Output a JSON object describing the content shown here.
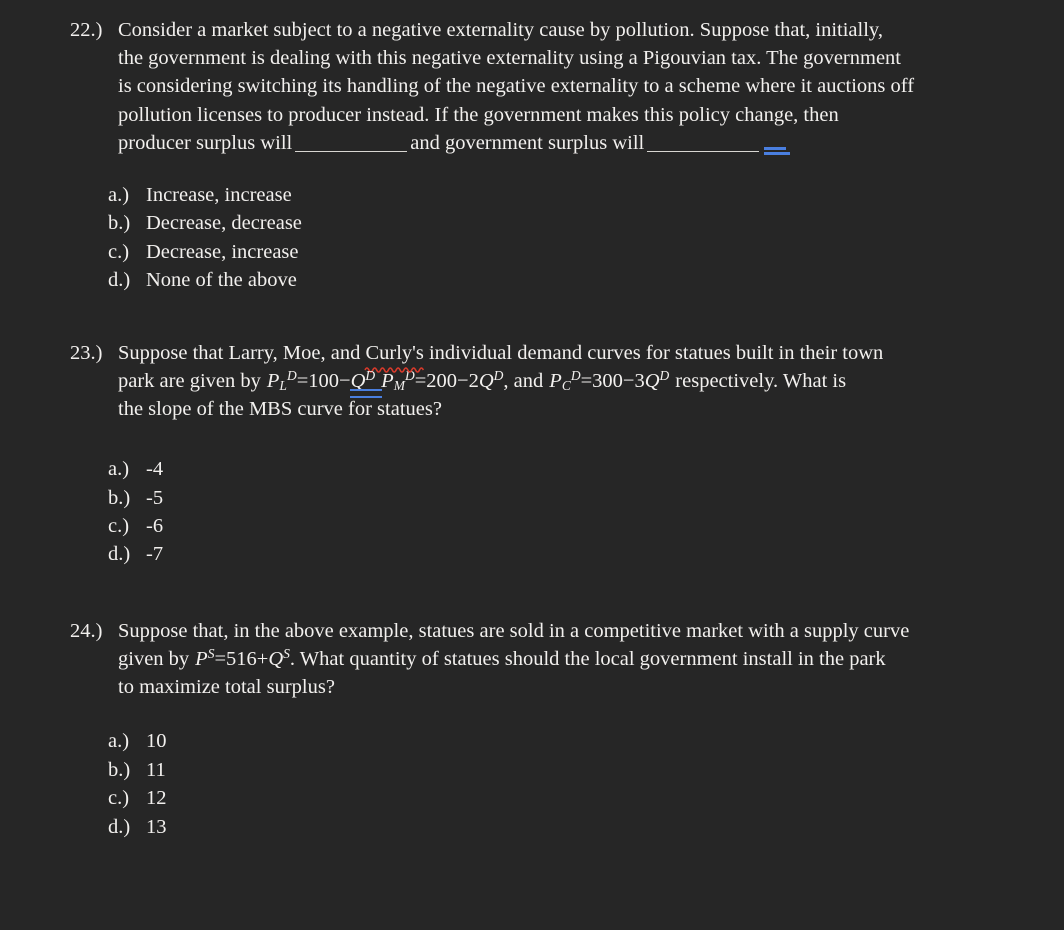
{
  "document": {
    "background_color": "#262626",
    "text_color": "#f2f0ee",
    "accent_blue": "#4a7fe0",
    "spellcheck_red": "#d93a2b"
  },
  "questions": [
    {
      "number": "22.)",
      "stem_lines": [
        "Consider a market subject to a negative externality cause by pollution.  Suppose that, initially,",
        "the government is dealing with this negative externality using a Pigouvian tax.  The government",
        "is considering switching its handling of the negative externality to a scheme where it auctions off",
        "pollution licenses to producer instead.  If the government makes this policy change, then",
        "producer surplus will ______________ and government surplus will ______________"
      ],
      "stem_part_a": "producer surplus will",
      "stem_part_b": "and government surplus will",
      "choices": [
        {
          "letter": "a.)",
          "text": "Increase, increase"
        },
        {
          "letter": "b.)",
          "text": "Decrease, decrease"
        },
        {
          "letter": "c.)",
          "text": "Decrease, increase"
        },
        {
          "letter": "d.)",
          "text": "None of the above"
        }
      ]
    },
    {
      "number": "23.)",
      "line1_before_spell": "Suppose that Larry, Moe, and ",
      "line1_spell_word": "Curly's",
      "line1_after_spell": " individual demand curves for statues built in their town",
      "line2_lead": "park are given by",
      "eq1": {
        "lhs_p": "P",
        "lhs_sub": "L",
        "lhs_sup": "D",
        "eq": "=",
        "rhs": "100−",
        "rhs_q": "Q",
        "rhs_q_sup": "D"
      },
      "eq2": {
        "lhs_p": "P",
        "lhs_sub": "M",
        "lhs_sup": "D",
        "eq": "=",
        "rhs": "200−2",
        "rhs_q": "Q",
        "rhs_q_sup": "D"
      },
      "eq2_tail": ", and",
      "eq3": {
        "lhs_p": "P",
        "lhs_sub": "C",
        "lhs_sup": "D",
        "eq": "=",
        "rhs": "300−3",
        "rhs_q": "Q",
        "rhs_q_sup": "D"
      },
      "eq3_tail": "respectively.  What is",
      "line3": "the slope of the MBS curve for statues?",
      "choices": [
        {
          "letter": "a.)",
          "text": "-4"
        },
        {
          "letter": "b.)",
          "text": "-5"
        },
        {
          "letter": "c.)",
          "text": "-6"
        },
        {
          "letter": "d.)",
          "text": "-7"
        }
      ]
    },
    {
      "number": "24.)",
      "line1": "Suppose that, in the above example, statues are sold in a competitive market with a supply curve",
      "line2_lead": "given by",
      "eq": {
        "lhs_p": "P",
        "lhs_sup": "S",
        "eq": "=",
        "rhs": "516+",
        "rhs_q": "Q",
        "rhs_q_sup": "S"
      },
      "line2_tail": ".  What quantity of statues should the local government install in the park",
      "line3": "to maximize total surplus?",
      "choices": [
        {
          "letter": "a.)",
          "text": "10"
        },
        {
          "letter": "b.)",
          "text": "11"
        },
        {
          "letter": "c.)",
          "text": "12"
        },
        {
          "letter": "d.)",
          "text": "13"
        }
      ]
    }
  ]
}
